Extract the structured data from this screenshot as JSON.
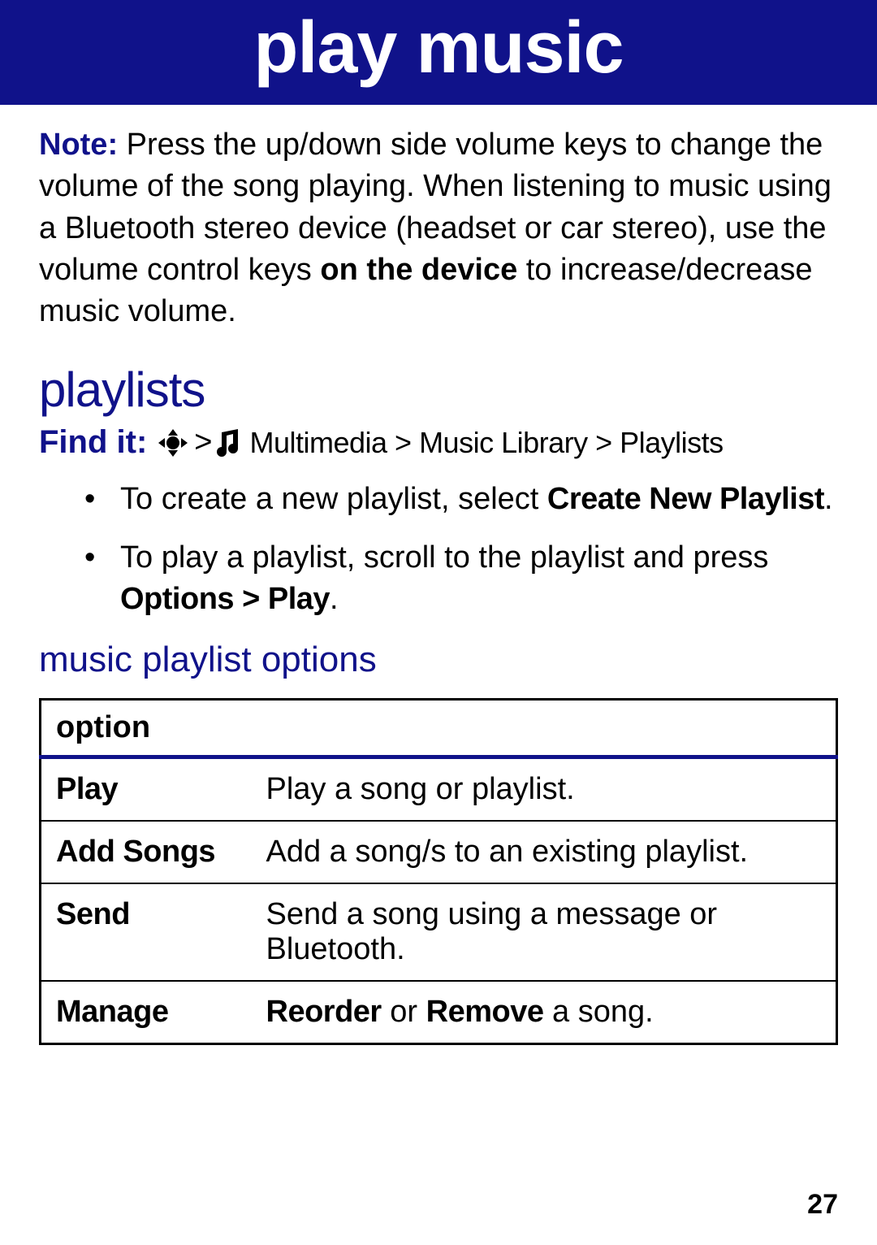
{
  "header": {
    "title": "play music"
  },
  "note": {
    "label": "Note:",
    "text_pre": " Press the up/down side volume keys to change the volume of the song playing. When listening to music using a Bluetooth stereo device (headset or car stereo), use the volume control keys ",
    "bold": "on the device",
    "text_post": " to increase/decrease music volume."
  },
  "section": {
    "heading": "playlists",
    "findit_label": "Find it:",
    "gt": ">",
    "path": "Multimedia > Music Library > Playlists"
  },
  "bullets": [
    {
      "pre": "To create a new playlist, select ",
      "bold": "Create New Playlist",
      "post": "."
    },
    {
      "pre": "To play a playlist, scroll to the playlist and press ",
      "bold": "Options > Play",
      "post": "."
    }
  ],
  "subheading": "music playlist options",
  "table": {
    "header": "option",
    "rows": [
      {
        "name": "Play",
        "desc_pre": "Play a song or playlist.",
        "bold1": "",
        "mid": "",
        "bold2": "",
        "post": ""
      },
      {
        "name": "Add Songs",
        "desc_pre": "Add a song/s to an existing playlist.",
        "bold1": "",
        "mid": "",
        "bold2": "",
        "post": ""
      },
      {
        "name": "Send",
        "desc_pre": "Send a song using a message or Bluetooth.",
        "bold1": "",
        "mid": "",
        "bold2": "",
        "post": ""
      },
      {
        "name": "Manage",
        "desc_pre": "",
        "bold1": "Reorder",
        "mid": " or ",
        "bold2": "Remove",
        "post": " a song."
      }
    ]
  },
  "page_number": "27"
}
